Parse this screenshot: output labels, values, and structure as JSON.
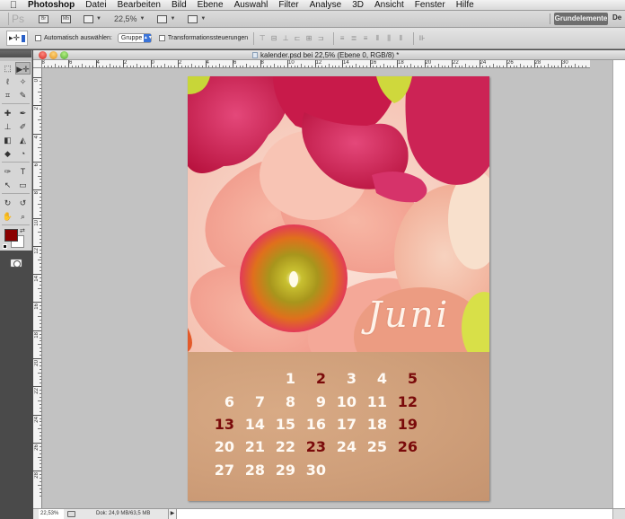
{
  "menubar": {
    "apple_icon": "apple-icon",
    "items": [
      "Photoshop",
      "Datei",
      "Bearbeiten",
      "Bild",
      "Ebene",
      "Auswahl",
      "Filter",
      "Analyse",
      "3D",
      "Ansicht",
      "Fenster",
      "Hilfe"
    ]
  },
  "appbar": {
    "logo": "Ps",
    "buttons": [
      {
        "icon": "bridge-icon",
        "label": "Br"
      },
      {
        "icon": "mini-bridge-icon",
        "label": "Mb"
      },
      {
        "icon": "view-extras-icon",
        "label": ""
      },
      {
        "icon": "zoom-level",
        "label": "22,5%"
      },
      {
        "icon": "arrange-documents-icon",
        "label": ""
      },
      {
        "icon": "screen-mode-icon",
        "label": ""
      }
    ],
    "workspace": "Grundelemente",
    "workspace_next": "De"
  },
  "options": {
    "tool_preset_icon": "move-tool-icon",
    "auto_select_label": "Automatisch auswählen:",
    "auto_select_checked": false,
    "auto_select_value": "Gruppe",
    "transform_label": "Transformationssteuerungen",
    "transform_checked": false,
    "align_icons": [
      "align-top-icon",
      "align-vertical-center-icon",
      "align-bottom-icon",
      "align-left-icon",
      "align-horizontal-center-icon",
      "align-right-icon"
    ],
    "distribute_icons": [
      "distribute-top-icon",
      "distribute-vertical-center-icon",
      "distribute-bottom-icon",
      "distribute-left-icon",
      "distribute-horizontal-center-icon",
      "distribute-right-icon"
    ],
    "auto_align_icon": "auto-align-layers-icon"
  },
  "tools": {
    "rows": [
      [
        {
          "name": "marquee-tool-icon",
          "glyph": "⬚"
        },
        {
          "name": "move-tool-icon",
          "glyph": "▶✛",
          "active": true
        }
      ],
      [
        {
          "name": "lasso-tool-icon",
          "glyph": "ℓ"
        },
        {
          "name": "quick-selection-tool-icon",
          "glyph": "✧"
        }
      ],
      [
        {
          "name": "crop-tool-icon",
          "glyph": "⌗"
        },
        {
          "name": "eyedropper-tool-icon",
          "glyph": "✎"
        }
      ],
      [
        {
          "name": "healing-brush-tool-icon",
          "glyph": "✚"
        },
        {
          "name": "brush-tool-icon",
          "glyph": "✒"
        }
      ],
      [
        {
          "name": "clone-stamp-tool-icon",
          "glyph": "⊥"
        },
        {
          "name": "history-brush-tool-icon",
          "glyph": "✐"
        }
      ],
      [
        {
          "name": "eraser-tool-icon",
          "glyph": "◧"
        },
        {
          "name": "paint-bucket-tool-icon",
          "glyph": "◭"
        }
      ],
      [
        {
          "name": "blur-tool-icon",
          "glyph": "◆"
        },
        {
          "name": "dodge-tool-icon",
          "glyph": "◔"
        }
      ],
      [
        {
          "name": "pen-tool-icon",
          "glyph": "✑"
        },
        {
          "name": "type-tool-icon",
          "glyph": "T"
        }
      ],
      [
        {
          "name": "path-selection-tool-icon",
          "glyph": "↖"
        },
        {
          "name": "rectangle-tool-icon",
          "glyph": "▭"
        }
      ],
      [
        {
          "name": "3d-rotate-tool-icon",
          "glyph": "↻"
        },
        {
          "name": "3d-orbit-tool-icon",
          "glyph": "↺"
        }
      ],
      [
        {
          "name": "hand-tool-icon",
          "glyph": "✋"
        },
        {
          "name": "zoom-tool-icon",
          "glyph": "⌕"
        }
      ]
    ],
    "foreground_color": "#8b0000",
    "background_color": "#ffffff",
    "swap_icon": "swap-colors-icon",
    "quickmask_icon": "quick-mask-icon"
  },
  "document": {
    "title": "kalender.psd bei 22,5% (Ebene 0, RGB/8) *",
    "hruler_labels": [
      "10",
      "8",
      "6",
      "4",
      "2",
      "0",
      "2",
      "4",
      "6",
      "8",
      "10",
      "12",
      "14",
      "16",
      "18",
      "20",
      "22",
      "24",
      "26",
      "28",
      "30"
    ],
    "vruler_labels": [
      "0",
      "2",
      "4",
      "6",
      "8",
      "10",
      "12",
      "14",
      "16",
      "18",
      "20",
      "22",
      "24",
      "26",
      "28"
    ],
    "calendar": {
      "month": "Juni",
      "weeks": [
        [
          null,
          null,
          "1",
          "2",
          "3",
          "4",
          "5"
        ],
        [
          "6",
          "7",
          "8",
          "9",
          "10",
          "11",
          "12"
        ],
        [
          "13",
          "14",
          "15",
          "16",
          "17",
          "18",
          "19"
        ],
        [
          "20",
          "21",
          "22",
          "23",
          "24",
          "25",
          "26"
        ],
        [
          "27",
          "28",
          "29",
          "30",
          null,
          null,
          null
        ]
      ],
      "highlighted_days": [
        "2",
        "5",
        "12",
        "13",
        "19",
        "23",
        "26"
      ],
      "highlight_color": "#7a0a0a",
      "day_color": "#fffaf4"
    }
  },
  "status": {
    "zoom": "22,53%",
    "doc_info": "Dok: 24,9 MB/63,5 MB",
    "arrow": "▶"
  }
}
